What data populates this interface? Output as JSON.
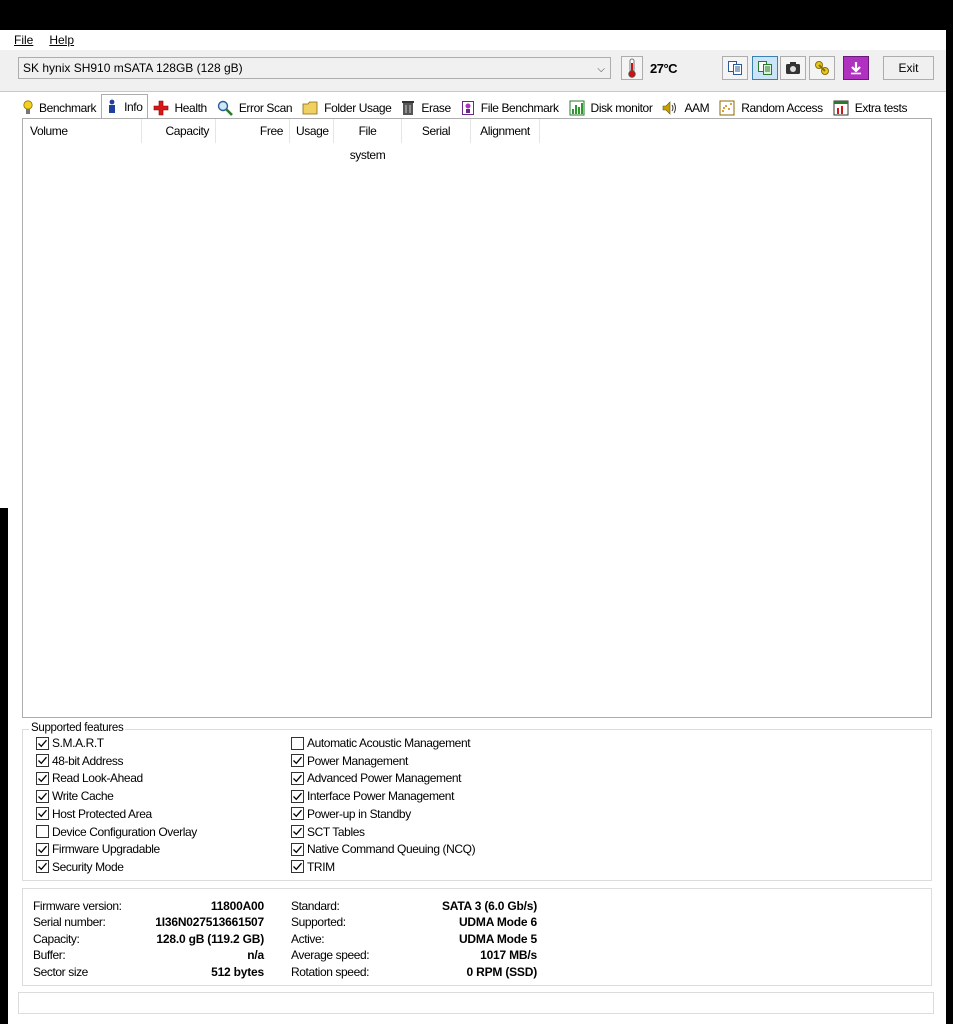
{
  "menu": {
    "file": "File",
    "help": "Help"
  },
  "toolbar": {
    "drive": "SK hynix SH910 mSATA 128GB (128 gB)",
    "temperature": "27°C",
    "exit_label": "Exit"
  },
  "tabs": [
    {
      "label": "Benchmark",
      "icon": "bulb-icon"
    },
    {
      "label": "Info",
      "icon": "info-icon"
    },
    {
      "label": "Health",
      "icon": "health-cross-icon"
    },
    {
      "label": "Error Scan",
      "icon": "magnifier-icon"
    },
    {
      "label": "Folder Usage",
      "icon": "folder-icon"
    },
    {
      "label": "Erase",
      "icon": "trash-icon"
    },
    {
      "label": "File Benchmark",
      "icon": "file-benchmark-icon"
    },
    {
      "label": "Disk monitor",
      "icon": "disk-monitor-icon"
    },
    {
      "label": "AAM",
      "icon": "speaker-icon"
    },
    {
      "label": "Random Access",
      "icon": "random-access-icon"
    },
    {
      "label": "Extra tests",
      "icon": "extra-tests-icon"
    }
  ],
  "volumes": {
    "headers": [
      "Volume",
      "Capacity",
      "Free",
      "Usage",
      "File system",
      "Serial",
      "Alignment"
    ]
  },
  "features": {
    "title": "Supported features",
    "left": [
      {
        "label": "S.M.A.R.T",
        "checked": true
      },
      {
        "label": "48-bit Address",
        "checked": true
      },
      {
        "label": "Read Look-Ahead",
        "checked": true
      },
      {
        "label": "Write Cache",
        "checked": true
      },
      {
        "label": "Host Protected Area",
        "checked": true
      },
      {
        "label": "Device Configuration Overlay",
        "checked": false
      },
      {
        "label": "Firmware Upgradable",
        "checked": true
      },
      {
        "label": "Security Mode",
        "checked": true
      }
    ],
    "right": [
      {
        "label": "Automatic Acoustic Management",
        "checked": false
      },
      {
        "label": "Power Management",
        "checked": true
      },
      {
        "label": "Advanced Power Management",
        "checked": true
      },
      {
        "label": "Interface Power Management",
        "checked": true
      },
      {
        "label": "Power-up in Standby",
        "checked": true
      },
      {
        "label": "SCT Tables",
        "checked": true
      },
      {
        "label": "Native Command Queuing (NCQ)",
        "checked": true
      },
      {
        "label": "TRIM",
        "checked": true
      }
    ]
  },
  "info": {
    "left": [
      {
        "label": "Firmware version:",
        "value": "11800A00"
      },
      {
        "label": "Serial number:",
        "value": "1I36N027513661507"
      },
      {
        "label": "Capacity:",
        "value": "128.0 gB (119.2 GB)"
      },
      {
        "label": "Buffer:",
        "value": "n/a"
      },
      {
        "label": "Sector size",
        "value": "512 bytes"
      }
    ],
    "right": [
      {
        "label": "Standard:",
        "value": "SATA 3 (6.0 Gb/s)"
      },
      {
        "label": "Supported:",
        "value": "UDMA Mode 6"
      },
      {
        "label": "Active:",
        "value": "UDMA Mode 5"
      },
      {
        "label": "Average speed:",
        "value": "1017 MB/s"
      },
      {
        "label": "Rotation speed:",
        "value": "0 RPM (SSD)"
      }
    ]
  }
}
